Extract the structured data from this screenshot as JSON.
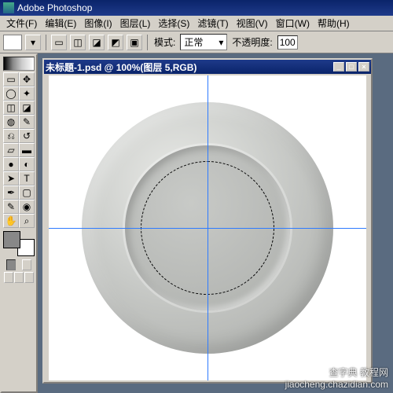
{
  "app": {
    "title": "Adobe Photoshop"
  },
  "menus": [
    "文件(F)",
    "编辑(E)",
    "图像(I)",
    "图层(L)",
    "选择(S)",
    "滤镜(T)",
    "视图(V)",
    "窗口(W)",
    "帮助(H)"
  ],
  "options": {
    "mode_label": "模式:",
    "mode_value": "正常",
    "opacity_label": "不透明度:",
    "opacity_value": "100"
  },
  "document": {
    "title": "未标題-1.psd @ 100%(图层 5,RGB)"
  },
  "watermark": {
    "line1": "查字典 教程网",
    "line2": "jiaocheng.chazidian.com"
  },
  "icons": {
    "marquee": "▭",
    "move": "✥",
    "lasso": "◯",
    "wand": "✦",
    "crop": "◫",
    "slice": "◪",
    "heal": "◍",
    "brush": "✎",
    "stamp": "⎌",
    "history": "↺",
    "eraser": "▱",
    "grad": "▬",
    "blur": "●",
    "dodge": "◐",
    "path": "➤",
    "type": "T",
    "pen": "✒",
    "shape": "▢",
    "notes": "✎",
    "eyedrop": "◉",
    "hand": "✋",
    "zoom": "⌕"
  }
}
